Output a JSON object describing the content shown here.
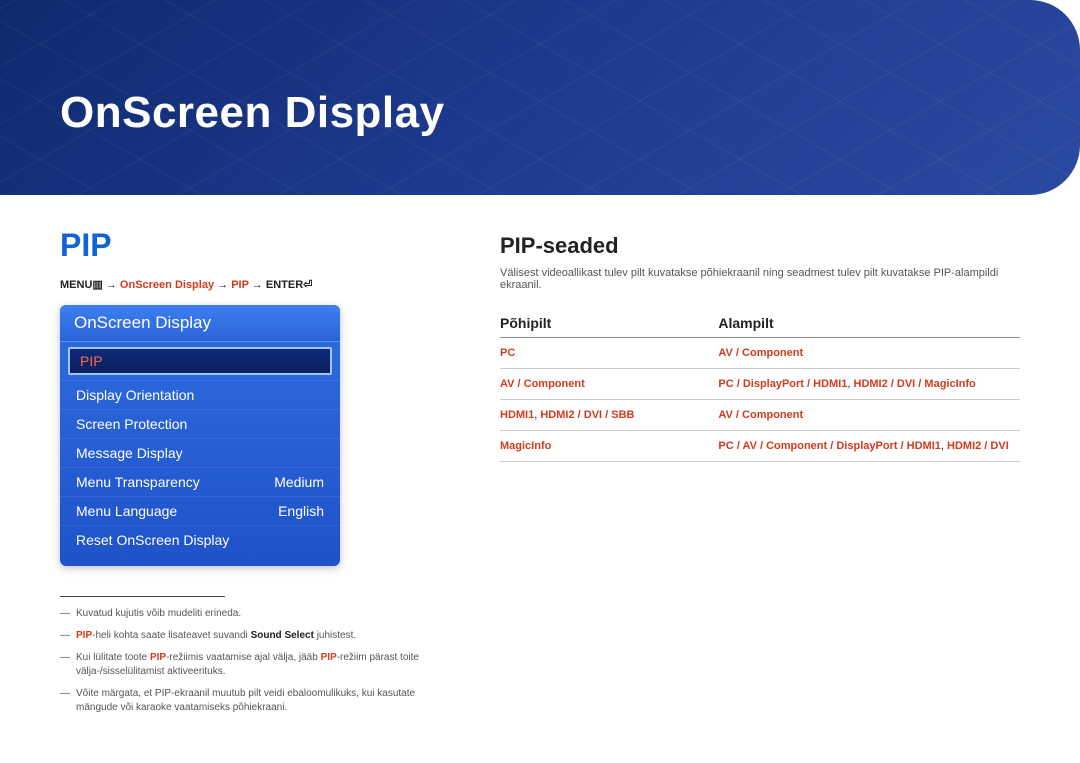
{
  "banner": {
    "title": "OnScreen Display"
  },
  "left": {
    "pip_title": "PIP",
    "breadcrumb": {
      "menu": "MENU",
      "menu_icon": "▥",
      "arrow": "→",
      "p1": "OnScreen Display",
      "p2": "PIP",
      "enter": "ENTER",
      "enter_icon": "⏎"
    },
    "menu": {
      "header": "OnScreen Display",
      "items": [
        {
          "label": "PIP",
          "value": "",
          "selected": true
        },
        {
          "label": "Display Orientation",
          "value": ""
        },
        {
          "label": "Screen Protection",
          "value": ""
        },
        {
          "label": "Message Display",
          "value": ""
        },
        {
          "label": "Menu Transparency",
          "value": "Medium"
        },
        {
          "label": "Menu Language",
          "value": "English"
        },
        {
          "label": "Reset OnScreen Display",
          "value": ""
        }
      ]
    },
    "notes": {
      "n1": "Kuvatud kujutis võib mudeliti erineda.",
      "n2a": "PIP",
      "n2b": "-heli kohta saate lisateavet suvandi ",
      "n2c": "Sound Select",
      "n2d": " juhistest.",
      "n3a": "Kui lülitate toote ",
      "n3b": "PIP",
      "n3c": "-režiimis vaatamise ajal välja, jääb ",
      "n3d": "PIP",
      "n3e": "-režiim pärast toite välja-/sisselülitamist aktiveerituks.",
      "n4": "Võite märgata, et PIP-ekraanil muutub pilt veidi ebaloomulikuks, kui kasutate mängude või karaoke vaatamiseks põhiekraani."
    }
  },
  "right": {
    "title": "PIP-seaded",
    "desc": "Välisest videoallikast tulev pilt kuvatakse põhiekraanil ning seadmest tulev pilt kuvatakse PIP-alampildi ekraanil.",
    "col1": "Põhipilt",
    "col2": "Alampilt",
    "rows": [
      {
        "c1": [
          [
            "PC"
          ]
        ],
        "c2": [
          [
            "AV"
          ],
          [
            "Component"
          ]
        ]
      },
      {
        "c1": [
          [
            "AV"
          ],
          [
            "Component"
          ]
        ],
        "c2": [
          [
            "PC"
          ],
          [
            "DisplayPort"
          ],
          [
            "HDMI1",
            ",",
            " HDMI2"
          ],
          [
            "DVI"
          ],
          [
            "MagicInfo"
          ]
        ]
      },
      {
        "c1": [
          [
            "HDMI1",
            ",",
            " HDMI2"
          ],
          [
            "DVI"
          ],
          [
            "SBB"
          ]
        ],
        "c2": [
          [
            "AV"
          ],
          [
            "Component"
          ]
        ]
      },
      {
        "c1": [
          [
            "MagicInfo"
          ]
        ],
        "c2": [
          [
            "PC"
          ],
          [
            "AV"
          ],
          [
            "Component"
          ],
          [
            "DisplayPort"
          ],
          [
            "HDMI1",
            ",",
            " HDMI2"
          ],
          [
            "DVI"
          ]
        ]
      }
    ]
  }
}
